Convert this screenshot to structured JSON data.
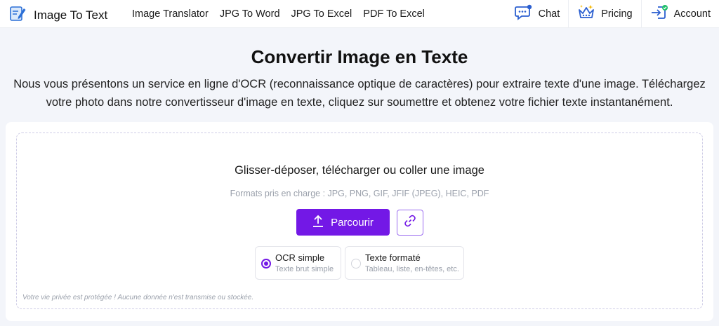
{
  "header": {
    "logo_text": "Image To Text",
    "nav": [
      "Image Translator",
      "JPG To Word",
      "JPG To Excel",
      "PDF To Excel"
    ],
    "right": [
      {
        "label": "Chat",
        "icon": "chat-icon"
      },
      {
        "label": "Pricing",
        "icon": "crown-icon"
      },
      {
        "label": "Account",
        "icon": "login-icon"
      }
    ]
  },
  "page": {
    "title": "Convertir Image en Texte",
    "description": "Nous vous présentons un service en ligne d'OCR (reconnaissance optique de caractères) pour extraire texte d'une image. Téléchargez votre photo dans notre convertisseur d'image en texte, cliquez sur soumettre et obtenez votre fichier texte instantanément."
  },
  "upload": {
    "heading": "Glisser-déposer, télécharger ou coller une image",
    "formats": "Formats pris en charge : JPG, PNG, GIF, JFIF (JPEG), HEIC, PDF",
    "browse_label": "Parcourir",
    "options": [
      {
        "title": "OCR simple",
        "subtitle": "Texte brut simple",
        "selected": true
      },
      {
        "title": "Texte formaté",
        "subtitle": "Tableau, liste, en-têtes, etc.",
        "selected": false
      }
    ],
    "privacy": "Votre vie privée est protégée ! Aucune donnée n'est transmise ou stockée."
  },
  "colors": {
    "accent": "#7318e6",
    "background": "#f3f5fa"
  }
}
